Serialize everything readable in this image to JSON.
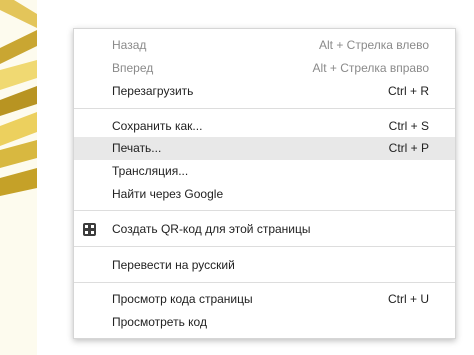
{
  "colors": {
    "menu_background": "#ffffff",
    "menu_border": "#d6d6d6",
    "text": "#222222",
    "disabled_text": "#8a8a8a",
    "hover_background": "#e8e8e8",
    "separator": "#dddddd",
    "decoration_gold": "#d4b23a"
  },
  "context_menu": {
    "back": {
      "label": "Назад",
      "shortcut": "Alt + Стрелка влево"
    },
    "forward": {
      "label": "Вперед",
      "shortcut": "Alt + Стрелка вправо"
    },
    "reload": {
      "label": "Перезагрузить",
      "shortcut": "Ctrl + R"
    },
    "save_as": {
      "label": "Сохранить как...",
      "shortcut": "Ctrl + S"
    },
    "print": {
      "label": "Печать...",
      "shortcut": "Ctrl + P"
    },
    "cast": {
      "label": "Трансляция..."
    },
    "search_google": {
      "label": "Найти через Google"
    },
    "qr_code": {
      "label": "Создать QR-код для этой страницы",
      "icon": "qr-code-icon"
    },
    "translate": {
      "label": "Перевести на русский"
    },
    "view_source": {
      "label": "Просмотр кода страницы",
      "shortcut": "Ctrl + U"
    },
    "inspect": {
      "label": "Просмотреть код"
    }
  }
}
